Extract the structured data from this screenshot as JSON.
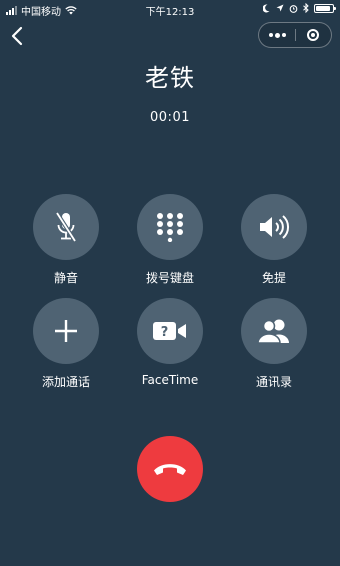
{
  "status_bar": {
    "carrier": "中国移动",
    "time": "下午12:13",
    "battery_level": 0.85
  },
  "nav": {
    "back_icon": "chevron-left-icon",
    "more_icon": "more-dots-icon",
    "close_icon": "target-close-icon"
  },
  "call": {
    "name": "老铁",
    "duration": "00:01"
  },
  "controls": [
    {
      "id": "mute",
      "label": "静音",
      "icon": "mic-off-icon"
    },
    {
      "id": "keypad",
      "label": "拨号键盘",
      "icon": "keypad-icon"
    },
    {
      "id": "speaker",
      "label": "免提",
      "icon": "speaker-icon"
    },
    {
      "id": "add-call",
      "label": "添加通话",
      "icon": "plus-icon"
    },
    {
      "id": "facetime",
      "label": "FaceTime",
      "icon": "facetime-icon"
    },
    {
      "id": "contacts",
      "label": "通讯录",
      "icon": "contacts-icon"
    }
  ],
  "end_call": {
    "icon": "hangup-icon",
    "color": "#ee3b3f"
  },
  "colors": {
    "background": "#24394a",
    "button_bg": "#4f6373",
    "end_call": "#ee3b3f"
  }
}
